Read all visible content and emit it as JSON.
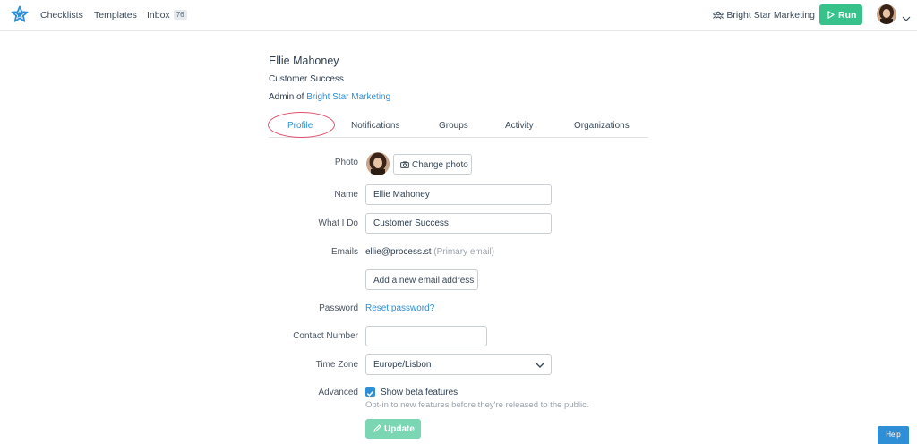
{
  "topnav": {
    "links": [
      "Checklists",
      "Templates",
      "Inbox"
    ],
    "inbox_count": "76",
    "org_name": "Bright Star Marketing",
    "run_label": "Run"
  },
  "profile": {
    "name": "Ellie Mahoney",
    "role": "Customer Success",
    "admin_prefix": "Admin of",
    "admin_org": "Bright Star Marketing"
  },
  "tabs": [
    "Profile",
    "Notifications",
    "Groups",
    "Activity",
    "Organizations"
  ],
  "form": {
    "photo_label": "Photo",
    "change_photo_label": "Change photo",
    "name_label": "Name",
    "name_value": "Ellie Mahoney",
    "what_label": "What I Do",
    "what_value": "Customer Success",
    "emails_label": "Emails",
    "email_value": "ellie@process.st",
    "email_note": "(Primary email)",
    "add_email_label": "Add a new email address",
    "password_label": "Password",
    "reset_password_label": "Reset password?",
    "contact_label": "Contact Number",
    "contact_value": "",
    "timezone_label": "Time Zone",
    "timezone_value": "Europe/Lisbon",
    "advanced_label": "Advanced",
    "beta_label": "Show beta features",
    "beta_checked": true,
    "beta_desc": "Opt-in to new features before they're released to the public.",
    "update_label": "Update"
  },
  "help_label": "Help",
  "colors": {
    "accent": "#2f8fd6",
    "run_green": "#36c28a",
    "update_green": "#7bd6b3",
    "annotation": "#e0506e"
  }
}
